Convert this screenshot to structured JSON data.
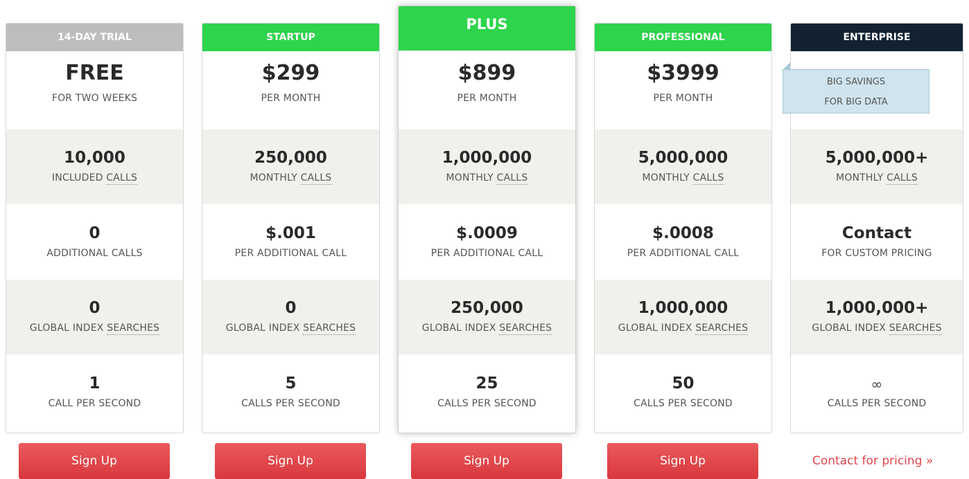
{
  "colors": {
    "trial_header": "#bdbdbd",
    "green_header": "#2ed44b",
    "enterprise_header": "#122233",
    "button_red": "#e04a4e",
    "link_red": "#e0464b",
    "savings_bg": "#cfe4ee"
  },
  "plans": [
    {
      "name": "14-DAY TRIAL",
      "price": "FREE",
      "price_sub": "FOR TWO WEEKS",
      "calls": "10,000",
      "calls_label_a": "INCLUDED",
      "calls_label_b": "CALLS",
      "additional": "0",
      "additional_label": "ADDITIONAL CALLS",
      "global": "0",
      "global_label_a": "GLOBAL INDEX",
      "global_label_b": "SEARCHES",
      "rate": "1",
      "rate_label": "CALL PER SECOND",
      "cta": "Sign Up"
    },
    {
      "name": "STARTUP",
      "price": "$299",
      "price_sub": "PER MONTH",
      "calls": "250,000",
      "calls_label_a": "MONTHLY",
      "calls_label_b": "CALLS",
      "additional": "$.001",
      "additional_label": "PER ADDITIONAL CALL",
      "global": "0",
      "global_label_a": "GLOBAL INDEX",
      "global_label_b": "SEARCHES",
      "rate": "5",
      "rate_label": "CALLS PER SECOND",
      "cta": "Sign Up"
    },
    {
      "name": "PLUS",
      "price": "$899",
      "price_sub": "PER MONTH",
      "calls": "1,000,000",
      "calls_label_a": "MONTHLY",
      "calls_label_b": "CALLS",
      "additional": "$.0009",
      "additional_label": "PER ADDITIONAL CALL",
      "global": "250,000",
      "global_label_a": "GLOBAL INDEX",
      "global_label_b": "SEARCHES",
      "rate": "25",
      "rate_label": "CALLS PER SECOND",
      "cta": "Sign Up"
    },
    {
      "name": "PROFESSIONAL",
      "price": "$3999",
      "price_sub": "PER MONTH",
      "calls": "5,000,000",
      "calls_label_a": "MONTHLY",
      "calls_label_b": "CALLS",
      "additional": "$.0008",
      "additional_label": "PER ADDITIONAL CALL",
      "global": "1,000,000",
      "global_label_a": "GLOBAL INDEX",
      "global_label_b": "SEARCHES",
      "rate": "50",
      "rate_label": "CALLS PER SECOND",
      "cta": "Sign Up"
    },
    {
      "name": "ENTERPRISE",
      "savings_line1": "BIG SAVINGS",
      "savings_line2": "FOR BIG DATA",
      "calls": "5,000,000+",
      "calls_label_a": "MONTHLY",
      "calls_label_b": "CALLS",
      "additional": "Contact",
      "additional_label": "FOR CUSTOM PRICING",
      "global": "1,000,000+",
      "global_label_a": "GLOBAL INDEX",
      "global_label_b": "SEARCHES",
      "rate": "∞",
      "rate_label": "CALLS PER SECOND",
      "cta": "Contact for pricing »"
    }
  ]
}
